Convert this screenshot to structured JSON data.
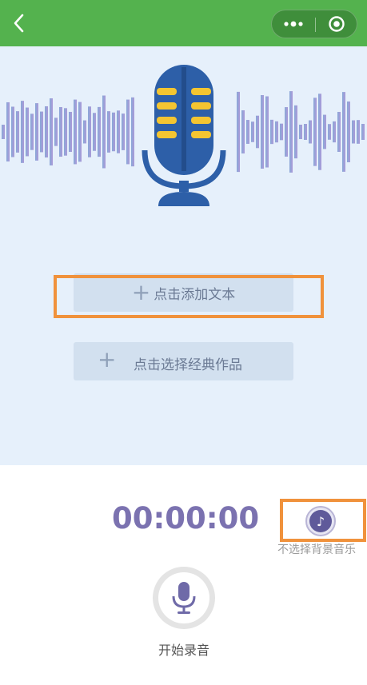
{
  "nav": {
    "back_icon": "chevron-left-icon",
    "more_icon": "more-dots-icon",
    "close_icon": "target-circle-icon",
    "bar_color": "#54b24e"
  },
  "hero": {
    "background": "#e6f0fb",
    "illustration": "microphone-icon",
    "wave_colors": [
      "#7fa1d4",
      "#a58fd4"
    ]
  },
  "actions": {
    "add_text": {
      "icon": "plus-icon",
      "label": "点击添加文本"
    },
    "choose_classic": {
      "icon": "plus-icon",
      "label": "点击选择经典作品"
    }
  },
  "recorder": {
    "timer": "00:00:00",
    "music_icon": "music-note-icon",
    "music_label": "不选择背景音乐",
    "record_icon": "microphone-icon",
    "record_label": "开始录音"
  },
  "highlight_color": "#f0923c"
}
